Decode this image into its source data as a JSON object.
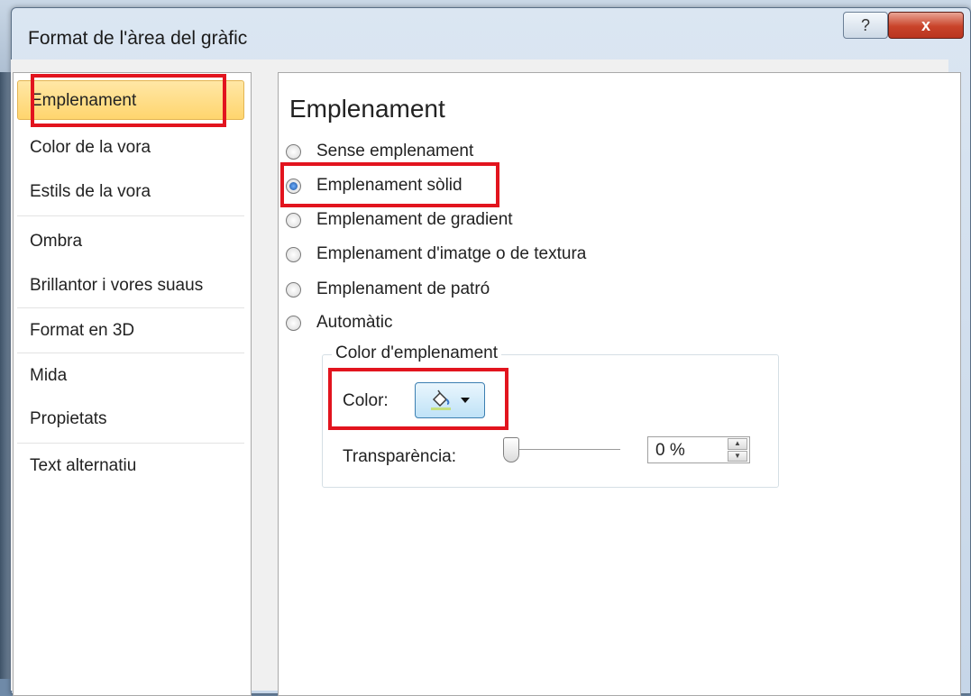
{
  "window": {
    "title": "Format de l'àrea del gràfic",
    "help_label": "?",
    "close_label": "x"
  },
  "nav": {
    "items": [
      {
        "label": "Emplenament",
        "selected": true
      },
      {
        "label": "Color de la vora"
      },
      {
        "label": "Estils de la vora"
      },
      {
        "label": "Ombra"
      },
      {
        "label": "Brillantor i vores suaus"
      },
      {
        "label": "Format en 3D"
      },
      {
        "label": "Mida"
      },
      {
        "label": "Propietats"
      },
      {
        "label": "Text alternatiu"
      }
    ]
  },
  "content": {
    "title": "Emplenament",
    "options": [
      {
        "label": "Sense emplenament",
        "checked": false
      },
      {
        "label": "Emplenament sòlid",
        "checked": true
      },
      {
        "label": "Emplenament de gradient",
        "checked": false
      },
      {
        "label": "Emplenament d'imatge o de textura",
        "checked": false
      },
      {
        "label": "Emplenament de patró",
        "checked": false
      },
      {
        "label": "Automàtic",
        "checked": false
      }
    ],
    "fill_color": {
      "legend": "Color d'emplenament",
      "color_label": "Color:",
      "color_button_icon": "paint-bucket-icon",
      "transparency_label": "Transparència:",
      "transparency_percent": 0,
      "transparency_value": "0 %"
    }
  },
  "colors": {
    "highlight": "#e2141e",
    "selected_nav": "#ffd56e",
    "close_button": "#c9432a"
  }
}
